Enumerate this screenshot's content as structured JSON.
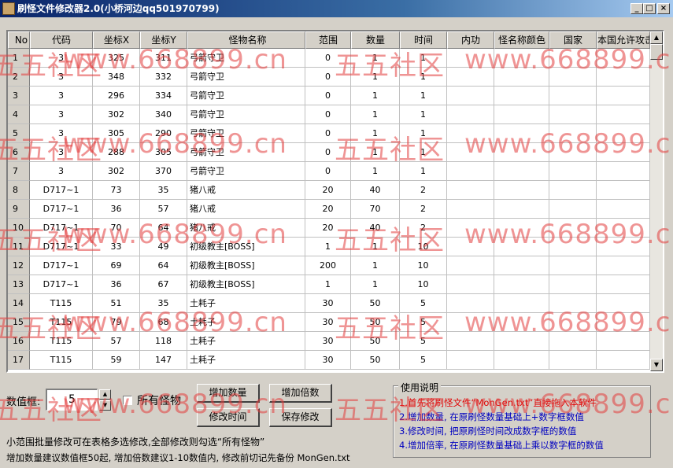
{
  "window": {
    "title": "刷怪文件修改器2.0(小桥河边qq501970799)",
    "controls": [
      "_",
      "□",
      "×"
    ]
  },
  "table": {
    "headers": [
      "No",
      "代码",
      "坐标X",
      "坐标Y",
      "怪物名称",
      "范围",
      "数量",
      "时间",
      "内功",
      "怪名称颜色",
      "国家",
      "本国允许攻击"
    ],
    "rows": [
      [
        "1",
        "3",
        "325",
        "311",
        "弓箭守卫",
        "0",
        "1",
        "1"
      ],
      [
        "2",
        "3",
        "348",
        "332",
        "弓箭守卫",
        "0",
        "1",
        "1"
      ],
      [
        "3",
        "3",
        "296",
        "334",
        "弓箭守卫",
        "0",
        "1",
        "1"
      ],
      [
        "4",
        "3",
        "302",
        "340",
        "弓箭守卫",
        "0",
        "1",
        "1"
      ],
      [
        "5",
        "3",
        "305",
        "290",
        "弓箭守卫",
        "0",
        "1",
        "1"
      ],
      [
        "6",
        "3",
        "288",
        "305",
        "弓箭守卫",
        "0",
        "1",
        "1"
      ],
      [
        "7",
        "3",
        "302",
        "370",
        "弓箭守卫",
        "0",
        "1",
        "1"
      ],
      [
        "8",
        "D717~1",
        "73",
        "35",
        "猪八戒",
        "20",
        "40",
        "2"
      ],
      [
        "9",
        "D717~1",
        "36",
        "57",
        "猪八戒",
        "20",
        "70",
        "2"
      ],
      [
        "10",
        "D717~1",
        "70",
        "64",
        "猪八戒",
        "20",
        "40",
        "2"
      ],
      [
        "11",
        "D717~1",
        "33",
        "49",
        "初级教主[BOSS]",
        "1",
        "1",
        "10"
      ],
      [
        "12",
        "D717~1",
        "69",
        "64",
        "初级教主[BOSS]",
        "200",
        "1",
        "10"
      ],
      [
        "13",
        "D717~1",
        "36",
        "67",
        "初级教主[BOSS]",
        "1",
        "1",
        "10"
      ],
      [
        "14",
        "T115",
        "51",
        "35",
        "土耗子",
        "30",
        "50",
        "5"
      ],
      [
        "15",
        "T115",
        "79",
        "68",
        "土耗子",
        "30",
        "50",
        "5"
      ],
      [
        "16",
        "T115",
        "57",
        "118",
        "土耗子",
        "30",
        "50",
        "5"
      ],
      [
        "17",
        "T115",
        "59",
        "147",
        "土耗子",
        "30",
        "50",
        "5"
      ]
    ]
  },
  "controls": {
    "value_label": "数值框:",
    "value": "5",
    "all_monsters_label": "所有怪物",
    "add_count": "增加数量",
    "add_multiplier": "增加倍数",
    "edit_time": "修改时间",
    "save_edit": "保存修改"
  },
  "notes": {
    "line1": "小范围批量修改可在表格多选修改,全部修改则勾选“所有怪物”",
    "line2": "增加数量建议数值框50起, 增加倍数建议1-10数值内, 修改前切记先备份 MonGen.txt"
  },
  "help": {
    "title": "使用说明",
    "items": [
      {
        "text": "1.首先将刷怪文件“MonGen.txt”直接拖入本软件",
        "color": "#e00000"
      },
      {
        "text": "2.增加数量, 在原刷怪数量基础上+数字框数值",
        "color": "#0000c0"
      },
      {
        "text": "3.修改时间, 把原刷怪时间改成数字框的数值",
        "color": "#0000c0"
      },
      {
        "text": "4.增加倍率, 在原刷怪数量基础上乘以数字框的数值",
        "color": "#0000c0"
      }
    ]
  },
  "watermarks": [
    "五五社区",
    "www.668899.cn"
  ]
}
